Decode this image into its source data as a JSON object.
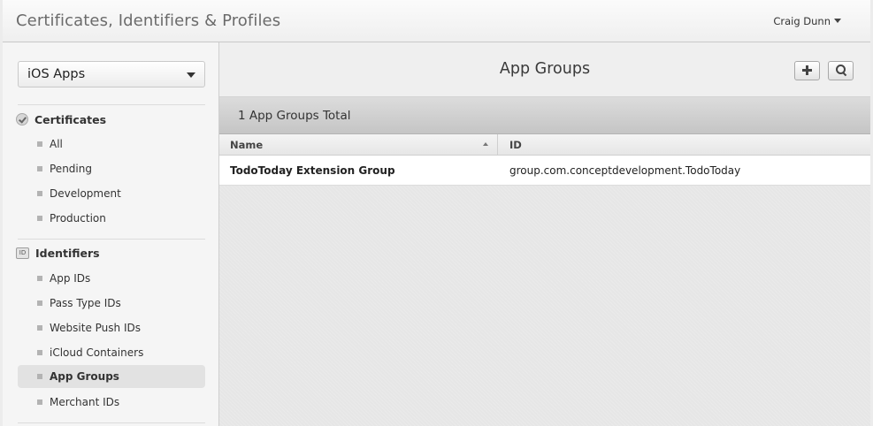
{
  "header": {
    "title": "Certificates, Identifiers & Profiles",
    "user_name": "Craig Dunn"
  },
  "sidebar": {
    "platform_select": "iOS Apps",
    "sections": [
      {
        "title": "Certificates",
        "icon": "certificate-icon",
        "items": [
          "All",
          "Pending",
          "Development",
          "Production"
        ]
      },
      {
        "title": "Identifiers",
        "icon": "id-icon",
        "icon_text": "ID",
        "items": [
          "App IDs",
          "Pass Type IDs",
          "Website Push IDs",
          "iCloud Containers",
          "App Groups",
          "Merchant IDs"
        ]
      }
    ],
    "active_item": "App Groups"
  },
  "main": {
    "title": "App Groups",
    "total_label": "1 App Groups Total",
    "columns": [
      "Name",
      "ID"
    ],
    "rows": [
      {
        "name": "TodoToday Extension Group",
        "id": "group.com.conceptdevelopment.TodoToday"
      }
    ]
  },
  "toolbar": {
    "add_icon": "plus-icon",
    "search_icon": "search-icon"
  }
}
